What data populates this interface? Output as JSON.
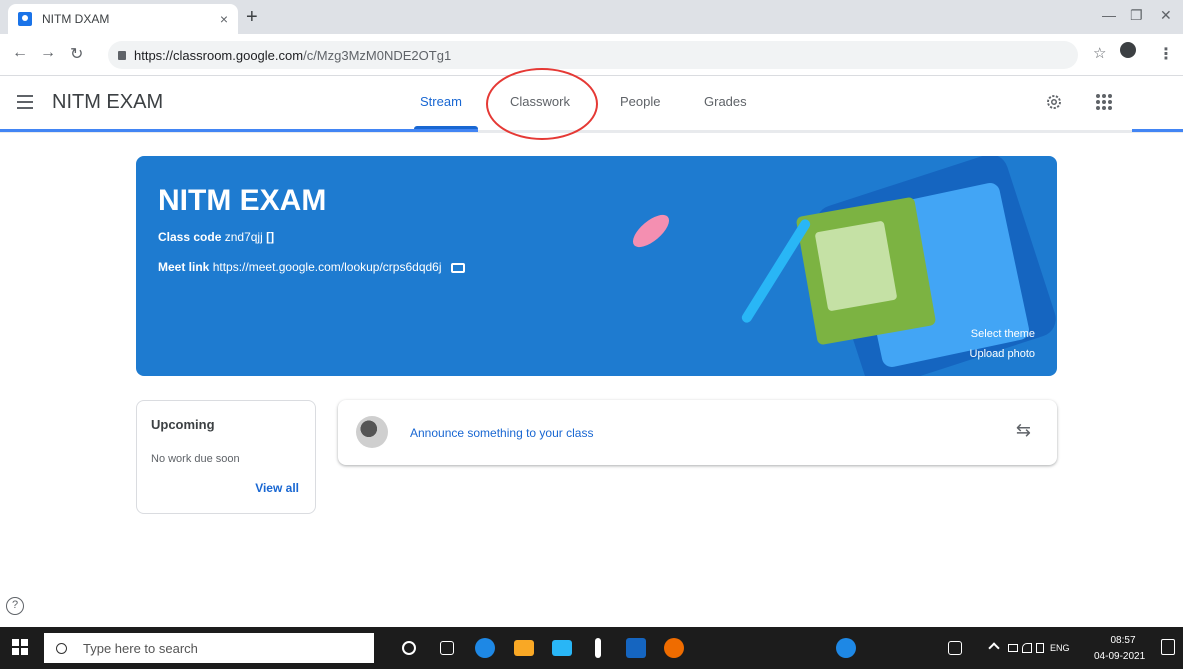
{
  "browser": {
    "tab_title": "NITM DXAM",
    "tab_close": "×",
    "new_tab": "+",
    "url_host": "https://classroom.google.com",
    "url_path": "/c/Mzg3MzM0NDE2OTg1"
  },
  "header": {
    "class_name": "NITM EXAM",
    "tabs": [
      {
        "label": "Stream"
      },
      {
        "label": "Classwork"
      },
      {
        "label": "People"
      },
      {
        "label": "Grades"
      }
    ]
  },
  "banner": {
    "title": "NITM EXAM",
    "class_code_label": "Class code",
    "class_code_value": "znd7qjj",
    "meet_link_label": "Meet link",
    "meet_link_value": "https://meet.google.com/lookup/crps6dqd6j",
    "select_theme": "Select theme",
    "upload_photo": "Upload photo"
  },
  "upcoming": {
    "title": "Upcoming",
    "empty_text": "No work due soon",
    "view_all": "View all"
  },
  "announce": {
    "placeholder": "Announce something to your class"
  },
  "taskbar": {
    "search_placeholder": "Type here to search",
    "tray_lang": "ENG",
    "time": "08:57",
    "date": "04-09-2021"
  },
  "colors": {
    "accent": "#1967d2",
    "banner": "#1e7bd0",
    "annotation_circle": "#e53935"
  }
}
